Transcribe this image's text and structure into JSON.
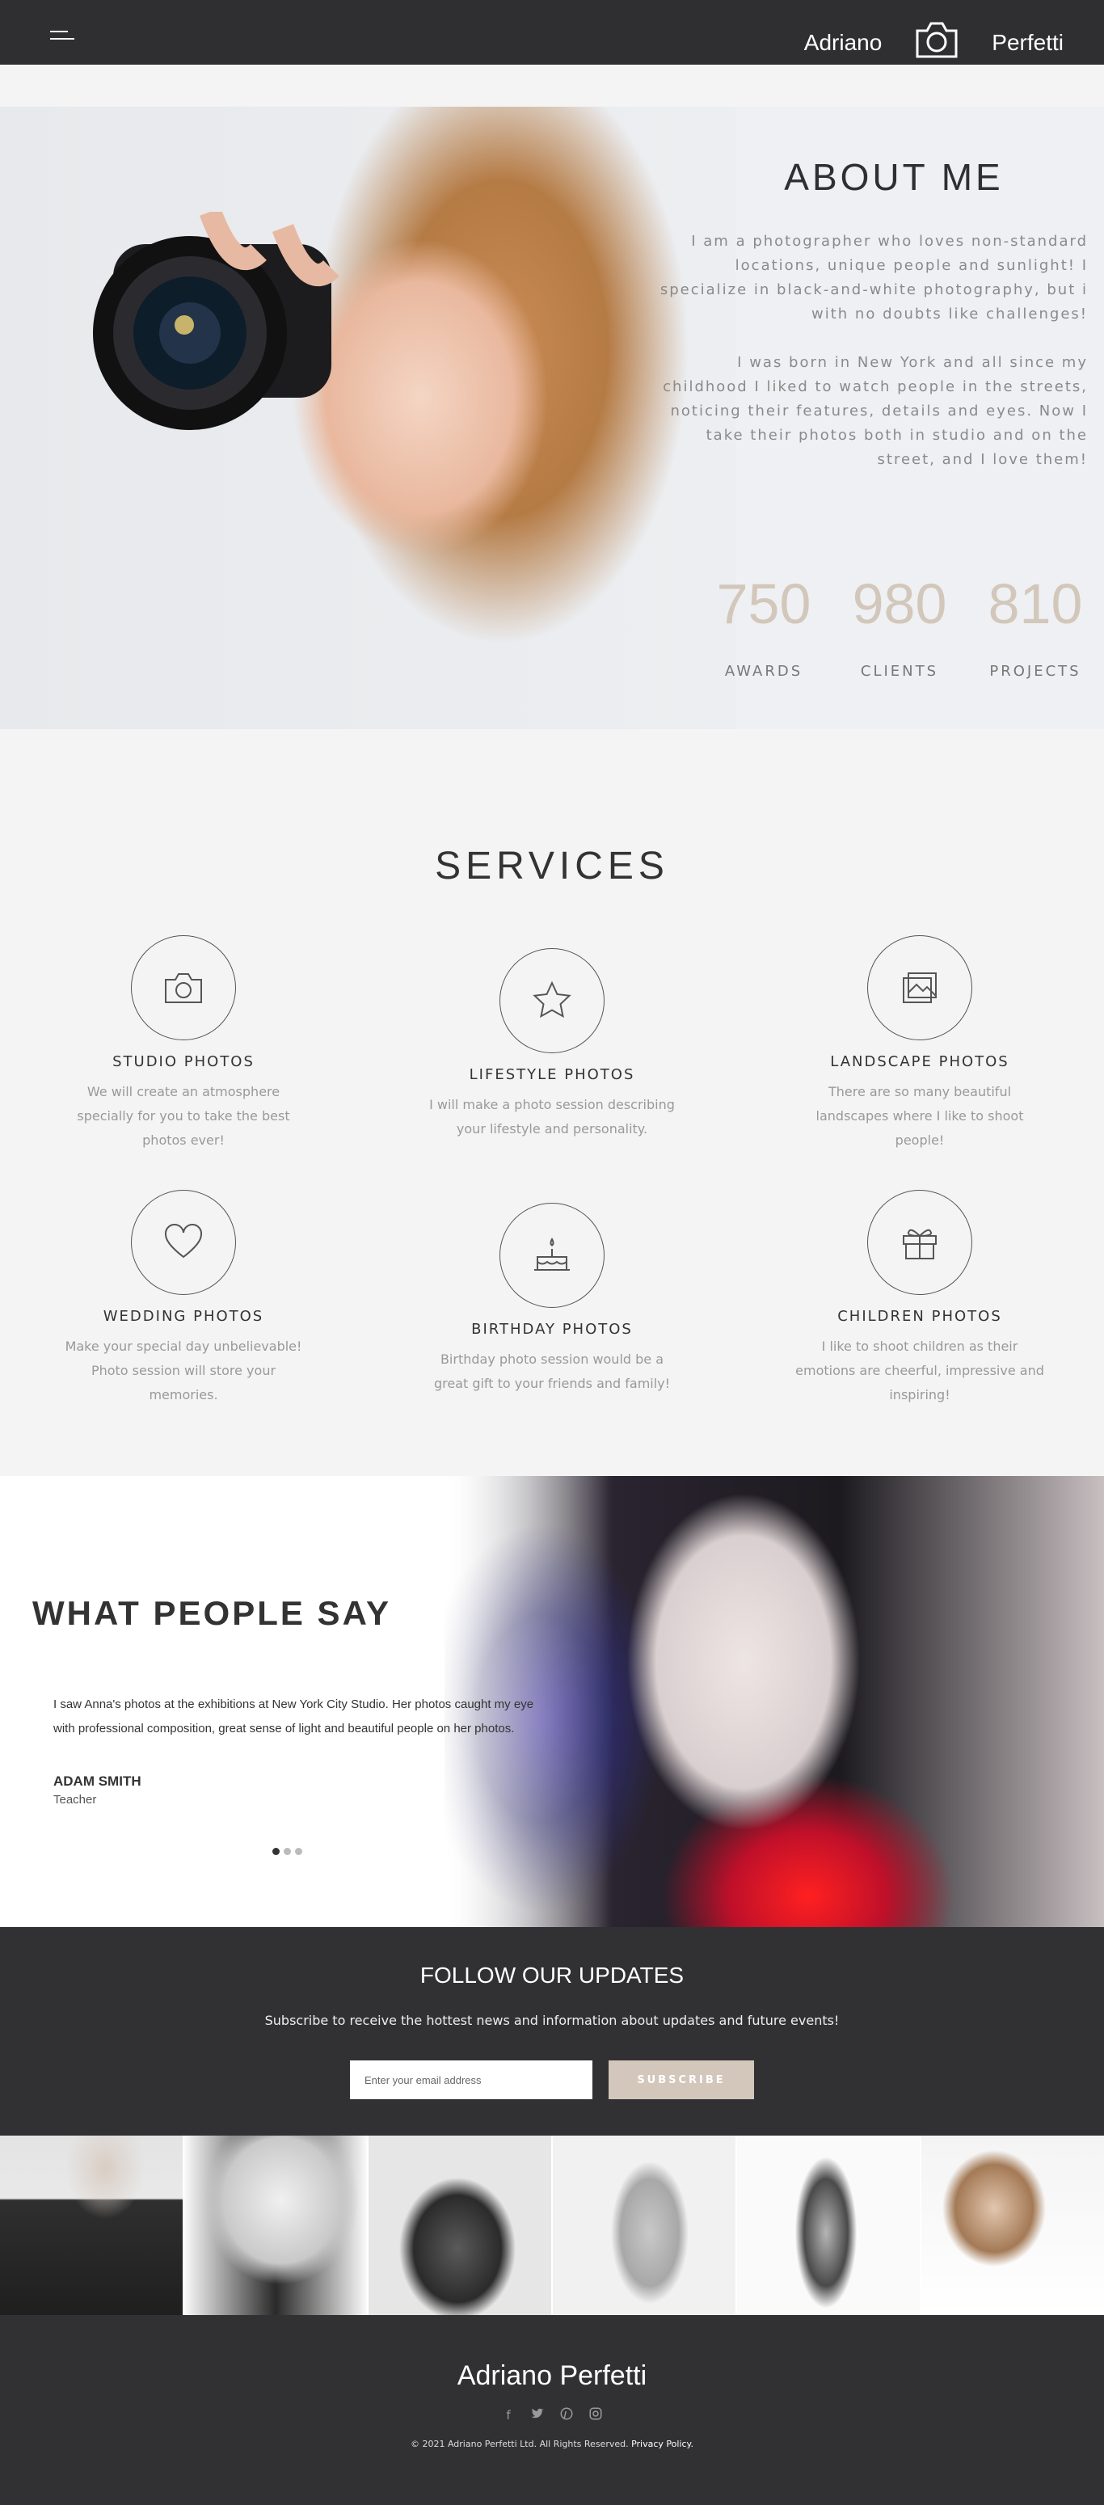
{
  "header": {
    "brand_first": "Adriano",
    "brand_last": "Perfetti",
    "menu_icon": "hamburger-menu-icon",
    "logo_icon": "camera-icon"
  },
  "about": {
    "title": "ABOUT ME",
    "paragraph1": "I am a photographer who loves non-standard locations, unique people and sunlight! I specialize in black-and-white photography, but i with no doubts like challenges!",
    "paragraph2": "I was born in New York and all since my childhood I liked to watch people in the streets, noticing their features, details and eyes. Now I take their photos both in studio and on the street, and I love them!",
    "stats": [
      {
        "value": "750",
        "label": "AWARDS"
      },
      {
        "value": "980",
        "label": "CLIENTS"
      },
      {
        "value": "810",
        "label": "PROJECTS"
      }
    ]
  },
  "services": {
    "title": "SERVICES",
    "items": [
      {
        "title": "STUDIO PHOTOS",
        "text": "We will create an atmosphere specially for you to take the best photos ever!",
        "icon": "camera-icon"
      },
      {
        "title": "LIFESTYLE PHOTOS",
        "text": "I will make a photo session describing your lifestyle and personality.",
        "icon": "star-icon"
      },
      {
        "title": "LANDSCAPE PHOTOS",
        "text": "There are so many beautiful landscapes where I like to shoot people!",
        "icon": "photos-icon"
      },
      {
        "title": "WEDDING PHOTOS",
        "text": "Make your special day unbelievable! Photo session will store your memories.",
        "icon": "heart-icon"
      },
      {
        "title": "BIRTHDAY PHOTOS",
        "text": "Birthday photo session would be a great gift to your friends and family!",
        "icon": "cake-icon"
      },
      {
        "title": "CHILDREN PHOTOS",
        "text": "I like to shoot children as their emotions are cheerful, impressive and inspiring!",
        "icon": "gift-icon"
      }
    ]
  },
  "testimonials": {
    "title": "WHAT PEOPLE SAY",
    "quote": "I saw Anna's photos at the exhibitions at New York City Studio. Her photos caught my eye with professional composition, great sense of light and beautiful people on her photos.",
    "name": "ADAM SMITH",
    "role": "Teacher",
    "slides": 3,
    "active_slide": 1
  },
  "subscribe": {
    "title": "FOLLOW OUR UPDATES",
    "text": "Subscribe to receive the hottest news and information about updates and future events!",
    "placeholder": "Enter your email address",
    "button": "SUBSCRIBE"
  },
  "footer": {
    "name": "Adriano Perfetti",
    "social_icons": [
      "facebook-icon",
      "twitter-icon",
      "pinterest-icon",
      "instagram-icon"
    ],
    "copyright": "© 2021 Adriano Perfetti Ltd. All Rights Reserved.",
    "privacy": "Privacy Policy."
  },
  "colors": {
    "dark": "#2f2f31",
    "accent": "#d2c7ba",
    "background": "#f4f4f4"
  }
}
